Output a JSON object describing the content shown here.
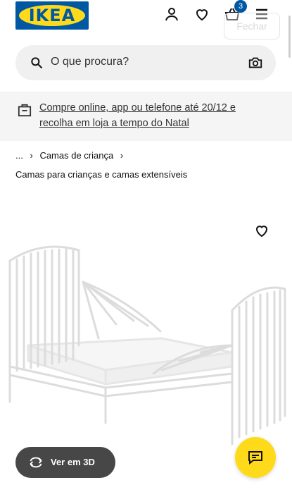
{
  "header": {
    "logo_text": "IKEA",
    "cart_count": "3",
    "close_label": "Fechar"
  },
  "search": {
    "placeholder": "O que procura?"
  },
  "banner": {
    "text": "Compre online, app ou telefone até 20/12 e recolha em loja a tempo do Natal"
  },
  "breadcrumb": {
    "ellipsis": "...",
    "category": "Camas de criança"
  },
  "page": {
    "subtitle": "Camas para crianças e camas extensíveis"
  },
  "actions": {
    "view3d_label": "Ver em 3D"
  },
  "colors": {
    "brand_blue": "#0058a3",
    "brand_yellow": "#ffda1a",
    "dark_button": "#474747"
  }
}
